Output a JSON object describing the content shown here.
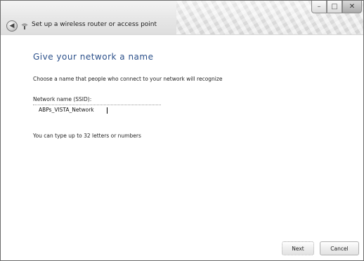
{
  "window": {
    "caption_min": "–",
    "caption_max": "□",
    "caption_close": "✕"
  },
  "wizard": {
    "title": "Set up a wireless router or access point"
  },
  "page": {
    "heading": "Give your network a name",
    "instruction": "Choose a name that people who connect to your network will recognize",
    "field_label": "Network name (SSID):",
    "ssid_value": "ABPs_VISTA_Network",
    "hint": "You can type up to 32 letters or numbers"
  },
  "buttons": {
    "next": "Next",
    "cancel": "Cancel"
  },
  "icons": {
    "back": "back-arrow-icon",
    "wizard": "wireless-network-icon"
  }
}
